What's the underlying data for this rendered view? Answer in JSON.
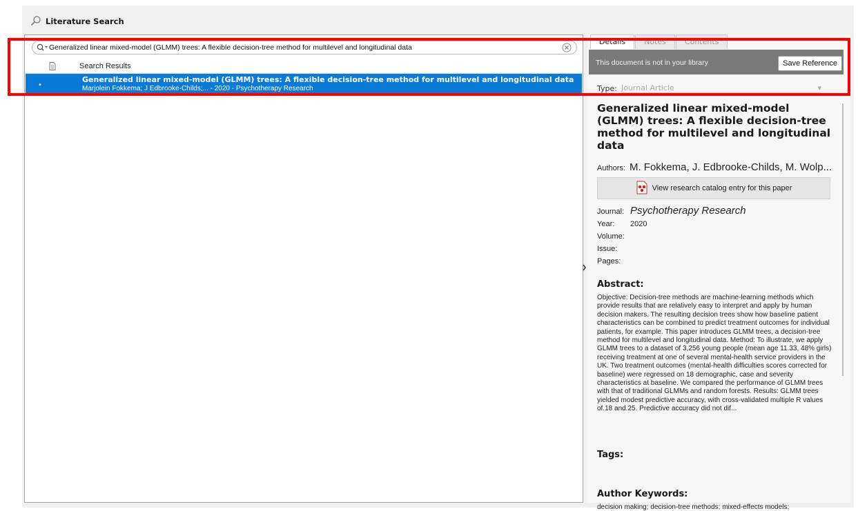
{
  "window": {
    "title": "Literature Search"
  },
  "search": {
    "query": "Generalized linear mixed-model (GLMM) trees: A flexible decision-tree method for multilevel and longitudinal data"
  },
  "results": {
    "column_header": "Search Results",
    "rows": [
      {
        "title": "Generalized linear mixed-model (GLMM) trees: A flexible decision-tree method for multilevel and longitudinal data",
        "meta": "Marjolein Fokkema; J Edbrooke-Childs;... - 2020 - Psychotherapy Research",
        "marker": "•"
      }
    ]
  },
  "details": {
    "tabs": [
      {
        "label": "Details",
        "active": true
      },
      {
        "label": "Notes",
        "active": false
      },
      {
        "label": "Contents",
        "active": false
      }
    ],
    "banner_text": "This document is not in your library",
    "save_button": "Save Reference",
    "type_label": "Type:",
    "type_value": "Journal Article",
    "title": "Generalized linear mixed-model (GLMM) trees: A flexible decision-tree method for multilevel and longitudinal data",
    "authors_label": "Authors:",
    "authors": "M. Fokkema, J. Edbrooke-Childs, M. Wolp...",
    "catalog_button": "View research catalog entry for this paper",
    "journal_label": "Journal:",
    "journal": "Psychotherapy Research",
    "year_label": "Year:",
    "year": "2020",
    "volume_label": "Volume:",
    "issue_label": "Issue:",
    "pages_label": "Pages:",
    "abstract_heading": "Abstract:",
    "abstract": "Objective: Decision-tree methods are machine-learning methods which provide results that are relatively easy to interpret and apply by human decision makers. The resulting decision trees show how baseline patient characteristics can be combined to predict treatment outcomes for individual patients, for example. This paper introduces GLMM trees, a decision-tree method for multilevel and longitudinal data. Method: To illustrate, we apply GLMM trees to a dataset of 3,256 young people (mean age 11.33, 48% girls) receiving treatment at one of several mental-health service providers in the UK. Two treatment outcomes (mental-health difficulties scores corrected for baseline) were regressed on 18 demographic, case and severity characteristics at baseline. We compared the performance of GLMM trees with that of traditional GLMMs and random forests. Results: GLMM trees yielded modest predictive accuracy, with cross-validated multiple R values of.18 and.25. Predictive accuracy did not dif...",
    "tags_heading": "Tags:",
    "keywords_heading": "Author Keywords:",
    "keywords": "decision making; decision-tree methods; mixed-effects models;"
  },
  "colors": {
    "selection": "#0a7ad6",
    "banner": "#7a7a7a",
    "highlight_box": "#ff0000"
  }
}
